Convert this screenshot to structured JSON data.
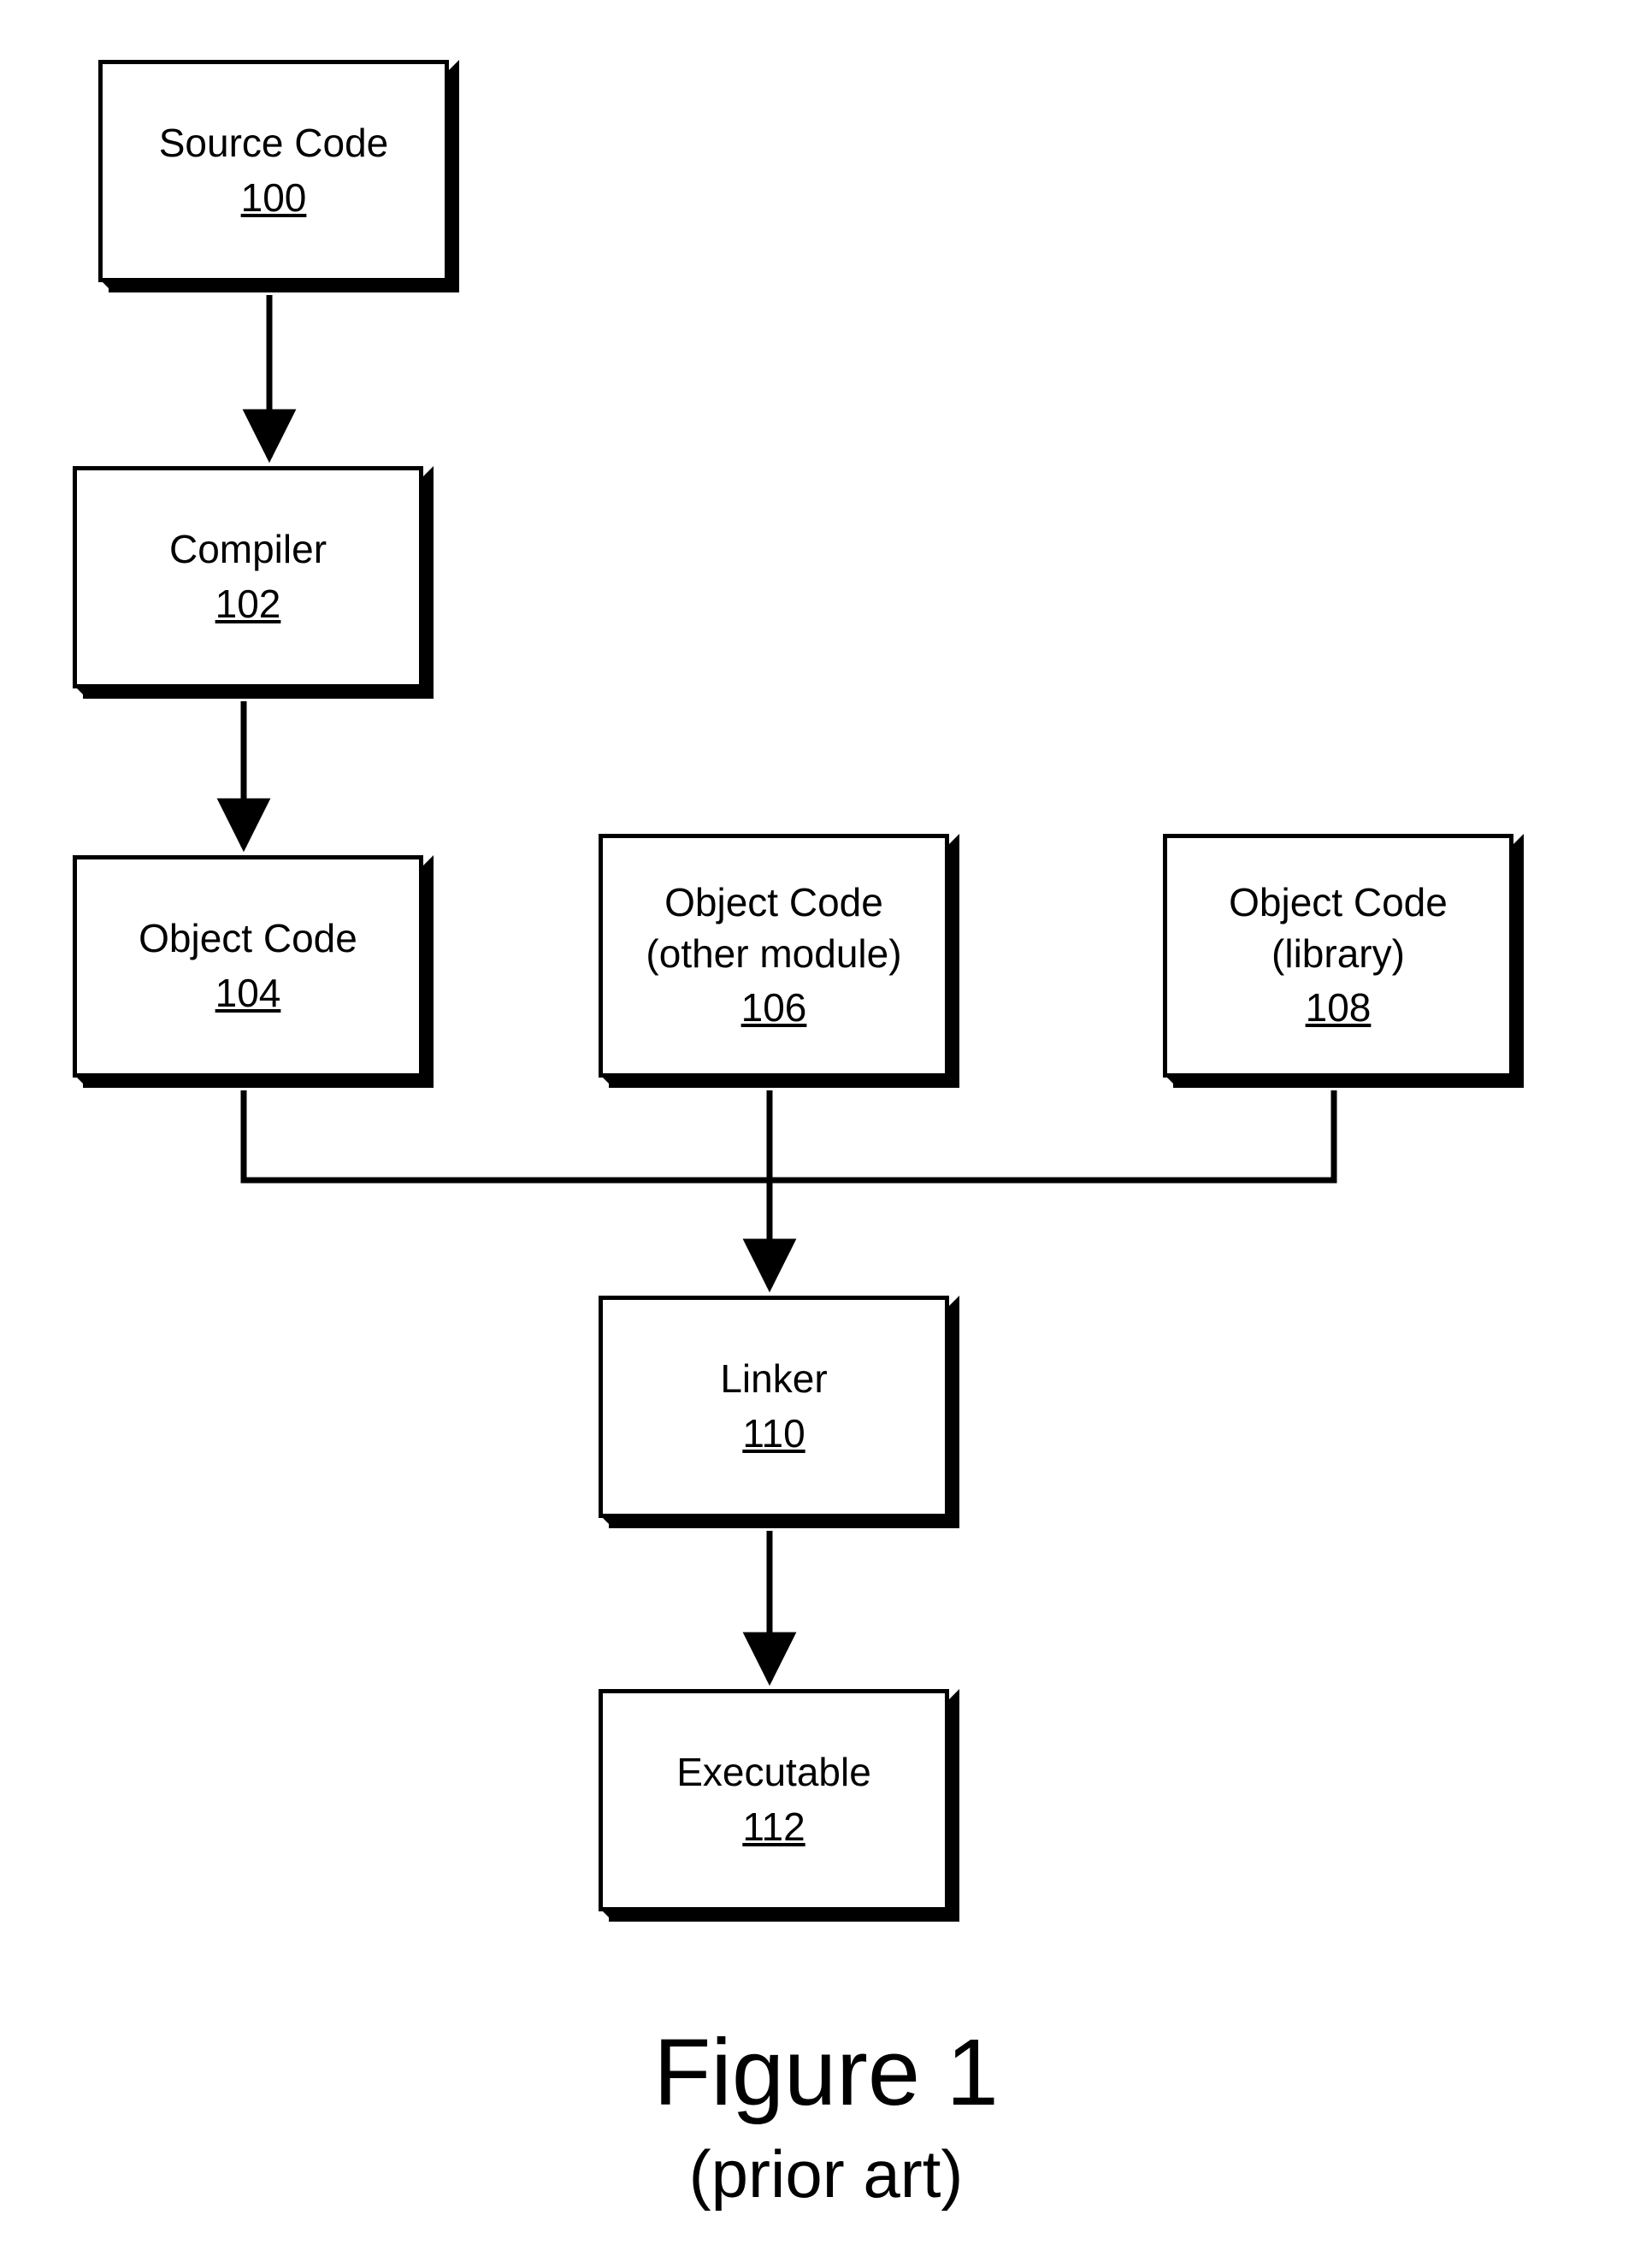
{
  "nodes": {
    "source": {
      "label": "Source Code",
      "num": "100"
    },
    "compiler": {
      "label": "Compiler",
      "num": "102"
    },
    "obj_main": {
      "label": "Object Code",
      "num": "104"
    },
    "obj_mod": {
      "label": "Object Code",
      "sub": "(other module)",
      "num": "106"
    },
    "obj_lib": {
      "label": "Object Code",
      "sub": "(library)",
      "num": "108"
    },
    "linker": {
      "label": "Linker",
      "num": "110"
    },
    "exe": {
      "label": "Executable",
      "num": "112"
    }
  },
  "caption": {
    "title": "Figure 1",
    "subtitle": "(prior art)"
  }
}
